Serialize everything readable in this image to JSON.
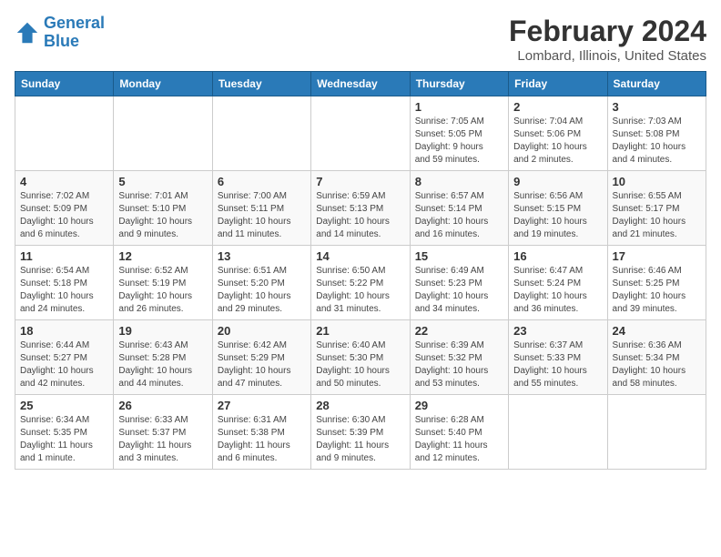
{
  "logo": {
    "line1": "General",
    "line2": "Blue"
  },
  "title": "February 2024",
  "subtitle": "Lombard, Illinois, United States",
  "weekdays": [
    "Sunday",
    "Monday",
    "Tuesday",
    "Wednesday",
    "Thursday",
    "Friday",
    "Saturday"
  ],
  "weeks": [
    [
      {
        "day": "",
        "info": ""
      },
      {
        "day": "",
        "info": ""
      },
      {
        "day": "",
        "info": ""
      },
      {
        "day": "",
        "info": ""
      },
      {
        "day": "1",
        "info": "Sunrise: 7:05 AM\nSunset: 5:05 PM\nDaylight: 9 hours\nand 59 minutes."
      },
      {
        "day": "2",
        "info": "Sunrise: 7:04 AM\nSunset: 5:06 PM\nDaylight: 10 hours\nand 2 minutes."
      },
      {
        "day": "3",
        "info": "Sunrise: 7:03 AM\nSunset: 5:08 PM\nDaylight: 10 hours\nand 4 minutes."
      }
    ],
    [
      {
        "day": "4",
        "info": "Sunrise: 7:02 AM\nSunset: 5:09 PM\nDaylight: 10 hours\nand 6 minutes."
      },
      {
        "day": "5",
        "info": "Sunrise: 7:01 AM\nSunset: 5:10 PM\nDaylight: 10 hours\nand 9 minutes."
      },
      {
        "day": "6",
        "info": "Sunrise: 7:00 AM\nSunset: 5:11 PM\nDaylight: 10 hours\nand 11 minutes."
      },
      {
        "day": "7",
        "info": "Sunrise: 6:59 AM\nSunset: 5:13 PM\nDaylight: 10 hours\nand 14 minutes."
      },
      {
        "day": "8",
        "info": "Sunrise: 6:57 AM\nSunset: 5:14 PM\nDaylight: 10 hours\nand 16 minutes."
      },
      {
        "day": "9",
        "info": "Sunrise: 6:56 AM\nSunset: 5:15 PM\nDaylight: 10 hours\nand 19 minutes."
      },
      {
        "day": "10",
        "info": "Sunrise: 6:55 AM\nSunset: 5:17 PM\nDaylight: 10 hours\nand 21 minutes."
      }
    ],
    [
      {
        "day": "11",
        "info": "Sunrise: 6:54 AM\nSunset: 5:18 PM\nDaylight: 10 hours\nand 24 minutes."
      },
      {
        "day": "12",
        "info": "Sunrise: 6:52 AM\nSunset: 5:19 PM\nDaylight: 10 hours\nand 26 minutes."
      },
      {
        "day": "13",
        "info": "Sunrise: 6:51 AM\nSunset: 5:20 PM\nDaylight: 10 hours\nand 29 minutes."
      },
      {
        "day": "14",
        "info": "Sunrise: 6:50 AM\nSunset: 5:22 PM\nDaylight: 10 hours\nand 31 minutes."
      },
      {
        "day": "15",
        "info": "Sunrise: 6:49 AM\nSunset: 5:23 PM\nDaylight: 10 hours\nand 34 minutes."
      },
      {
        "day": "16",
        "info": "Sunrise: 6:47 AM\nSunset: 5:24 PM\nDaylight: 10 hours\nand 36 minutes."
      },
      {
        "day": "17",
        "info": "Sunrise: 6:46 AM\nSunset: 5:25 PM\nDaylight: 10 hours\nand 39 minutes."
      }
    ],
    [
      {
        "day": "18",
        "info": "Sunrise: 6:44 AM\nSunset: 5:27 PM\nDaylight: 10 hours\nand 42 minutes."
      },
      {
        "day": "19",
        "info": "Sunrise: 6:43 AM\nSunset: 5:28 PM\nDaylight: 10 hours\nand 44 minutes."
      },
      {
        "day": "20",
        "info": "Sunrise: 6:42 AM\nSunset: 5:29 PM\nDaylight: 10 hours\nand 47 minutes."
      },
      {
        "day": "21",
        "info": "Sunrise: 6:40 AM\nSunset: 5:30 PM\nDaylight: 10 hours\nand 50 minutes."
      },
      {
        "day": "22",
        "info": "Sunrise: 6:39 AM\nSunset: 5:32 PM\nDaylight: 10 hours\nand 53 minutes."
      },
      {
        "day": "23",
        "info": "Sunrise: 6:37 AM\nSunset: 5:33 PM\nDaylight: 10 hours\nand 55 minutes."
      },
      {
        "day": "24",
        "info": "Sunrise: 6:36 AM\nSunset: 5:34 PM\nDaylight: 10 hours\nand 58 minutes."
      }
    ],
    [
      {
        "day": "25",
        "info": "Sunrise: 6:34 AM\nSunset: 5:35 PM\nDaylight: 11 hours\nand 1 minute."
      },
      {
        "day": "26",
        "info": "Sunrise: 6:33 AM\nSunset: 5:37 PM\nDaylight: 11 hours\nand 3 minutes."
      },
      {
        "day": "27",
        "info": "Sunrise: 6:31 AM\nSunset: 5:38 PM\nDaylight: 11 hours\nand 6 minutes."
      },
      {
        "day": "28",
        "info": "Sunrise: 6:30 AM\nSunset: 5:39 PM\nDaylight: 11 hours\nand 9 minutes."
      },
      {
        "day": "29",
        "info": "Sunrise: 6:28 AM\nSunset: 5:40 PM\nDaylight: 11 hours\nand 12 minutes."
      },
      {
        "day": "",
        "info": ""
      },
      {
        "day": "",
        "info": ""
      }
    ]
  ]
}
